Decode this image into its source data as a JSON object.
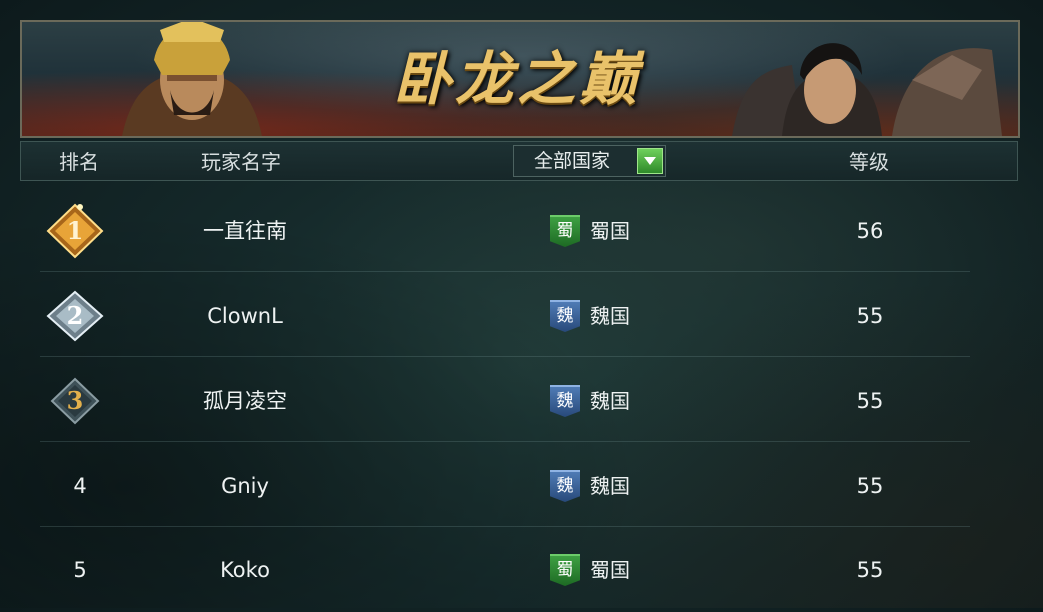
{
  "banner": {
    "title": "卧龙之巅"
  },
  "header": {
    "rank_label": "排名",
    "name_label": "玩家名字",
    "filter_label": "全部国家",
    "level_label": "等级"
  },
  "rows": [
    {
      "rank": "1",
      "name": "一直往南",
      "flag": "蜀",
      "country": "蜀国",
      "level": "56"
    },
    {
      "rank": "2",
      "name": "ClownL",
      "flag": "魏",
      "country": "魏国",
      "level": "55"
    },
    {
      "rank": "3",
      "name": "孤月凌空",
      "flag": "魏",
      "country": "魏国",
      "level": "55"
    },
    {
      "rank": "4",
      "name": "Gniy",
      "flag": "魏",
      "country": "魏国",
      "level": "55"
    },
    {
      "rank": "5",
      "name": "Koko",
      "flag": "蜀",
      "country": "蜀国",
      "level": "55"
    }
  ],
  "colors": {
    "shu": "#2f8a34",
    "wei": "#3e64a0",
    "gold": "#e9c26a"
  }
}
